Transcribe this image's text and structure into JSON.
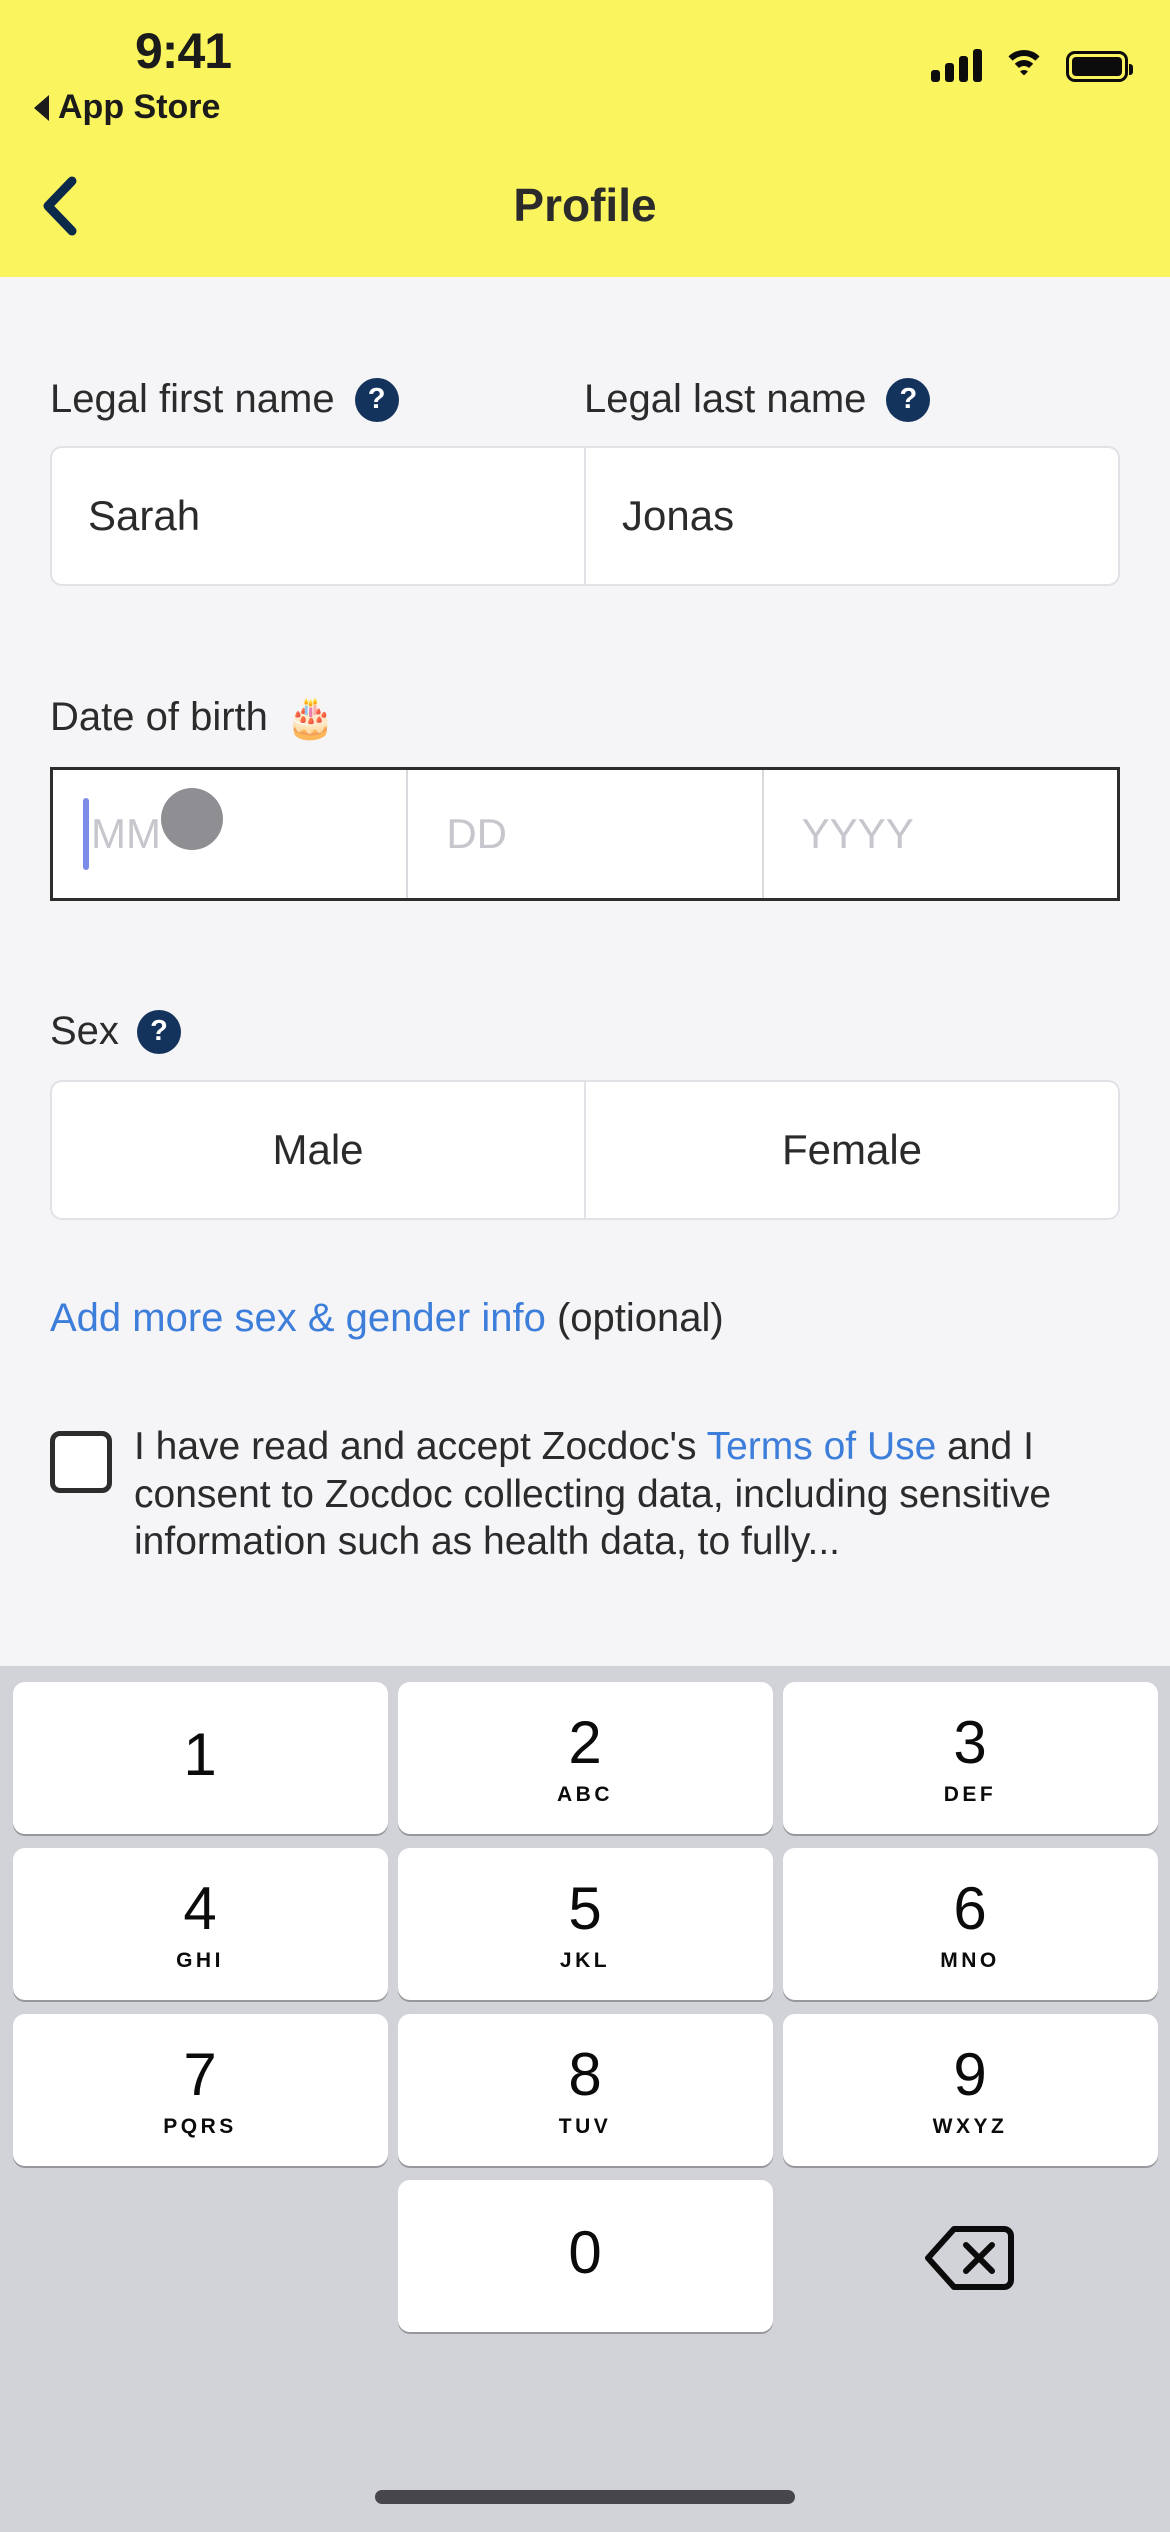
{
  "status_bar": {
    "time": "9:41",
    "back_app": "App Store",
    "icons": [
      "cellular-signal-icon",
      "wifi-icon",
      "battery-icon"
    ]
  },
  "header": {
    "title": "Profile",
    "back_icon": "chevron-left-icon",
    "background_color": "#faf55e",
    "title_color": "#2b2b2b"
  },
  "form": {
    "first_name": {
      "label": "Legal first name",
      "help_icon": "question-mark-icon",
      "value": "Sarah",
      "placeholder": "Legal first name"
    },
    "last_name": {
      "label": "Legal last name",
      "help_icon": "question-mark-icon",
      "value": "Jonas",
      "placeholder": "Legal last name"
    },
    "dob": {
      "label": "Date of birth",
      "emoji": "🎂",
      "month_placeholder": "MM",
      "day_placeholder": "DD",
      "year_placeholder": "YYYY",
      "month_value": "",
      "day_value": "",
      "year_value": "",
      "focused_field": "MM",
      "caret_color": "#7b8ce8",
      "touch_indicator_color": "#8e8e93"
    },
    "sex": {
      "label": "Sex",
      "help_icon": "question-mark-icon",
      "options": [
        "Male",
        "Female"
      ],
      "selected": ""
    },
    "gender_link": {
      "link_text": "Add more sex & gender info",
      "suffix": " (optional)",
      "link_color": "#3d7edb"
    },
    "consent": {
      "checked": false,
      "part1": "I have read and accept Zocdoc's ",
      "link1": "Terms",
      "part2": " ",
      "link2": "of Use",
      "part3": " and I consent to Zocdoc collecting data, including sensitive information such as health data, to fully..."
    }
  },
  "keyboard": {
    "type": "numeric-keypad",
    "keys": [
      {
        "num": "1",
        "alpha": ""
      },
      {
        "num": "2",
        "alpha": "ABC"
      },
      {
        "num": "3",
        "alpha": "DEF"
      },
      {
        "num": "4",
        "alpha": "GHI"
      },
      {
        "num": "5",
        "alpha": "JKL"
      },
      {
        "num": "6",
        "alpha": "MNO"
      },
      {
        "num": "7",
        "alpha": "PQRS"
      },
      {
        "num": "8",
        "alpha": "TUV"
      },
      {
        "num": "9",
        "alpha": "WXYZ"
      },
      {
        "num": "0",
        "alpha": ""
      }
    ],
    "delete_icon": "backspace-delete-icon",
    "background_color": "#d1d3d8"
  },
  "colors": {
    "page_background": "#f5f4f7",
    "accent_navy": "#14335c",
    "link_blue": "#3d7edb",
    "brand_yellow": "#faf55e"
  }
}
